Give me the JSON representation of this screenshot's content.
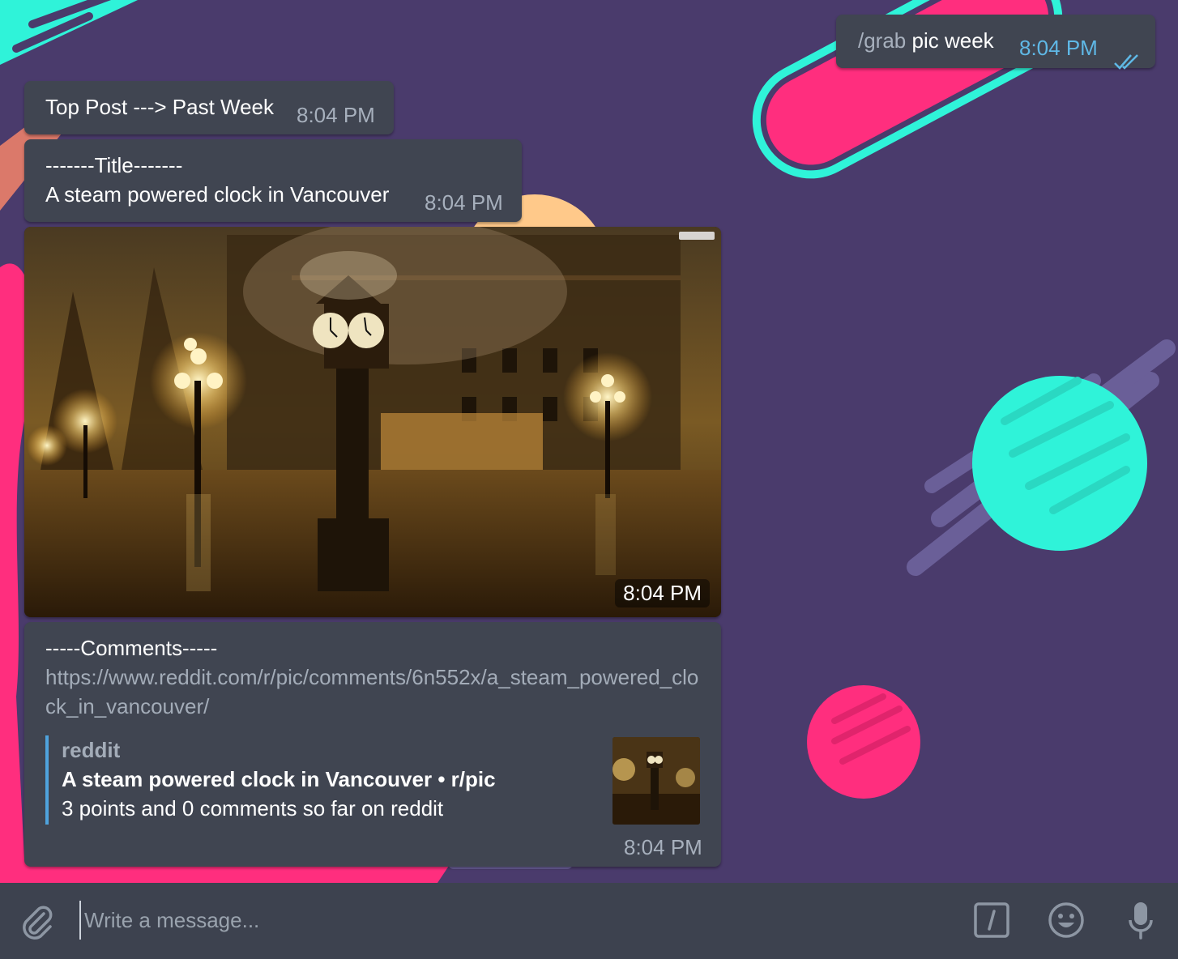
{
  "outgoing": {
    "command": "/grab",
    "text": "pic week",
    "time": "8:04 PM"
  },
  "messages": [
    {
      "text": "Top Post ---> Past Week",
      "time": "8:04 PM"
    },
    {
      "line1": "-------Title-------",
      "line2": "A steam powered clock in Vancouver",
      "time": "8:04 PM"
    }
  ],
  "photo": {
    "time": "8:04 PM",
    "watermark": "YouWall.com"
  },
  "comments": {
    "header": "-----Comments-----",
    "url": "https://www.reddit.com/r/pic/comments/6n552x/a_steam_powered_clock_in_vancouver/",
    "preview": {
      "site": "reddit",
      "title": "A steam powered clock in Vancouver • r/pic",
      "description": "3 points and 0 comments so far on reddit"
    },
    "time": "8:04 PM"
  },
  "composer": {
    "placeholder": "Write a message..."
  },
  "colors": {
    "bubble": "#404551",
    "background": "#493c6e",
    "accent_pink": "#ff2e7e",
    "accent_cyan": "#2ff3d9",
    "link_bar": "#4fa3dd"
  }
}
